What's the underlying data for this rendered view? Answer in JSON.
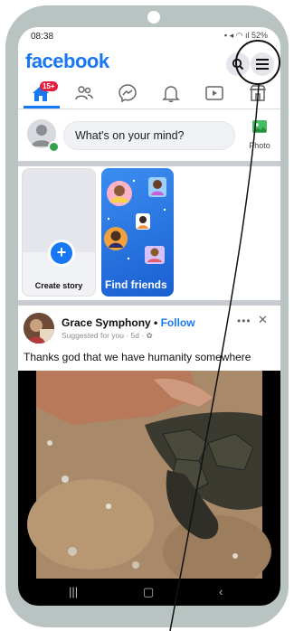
{
  "status_bar": {
    "time": "08:38",
    "battery": "52%"
  },
  "header": {
    "logo": "facebook"
  },
  "nav": {
    "notification_badge": "15+"
  },
  "composer": {
    "placeholder": "What's on your mind?",
    "photo_label": "Photo"
  },
  "stories": {
    "create_label": "Create story",
    "find_friends_label": "Find friends"
  },
  "post": {
    "author": "Grace Symphony",
    "separator": "•",
    "follow_label": "Follow",
    "meta": "Suggested for you · 5d ·",
    "text": "Thanks god that we have humanity somewhere"
  },
  "colors": {
    "brand": "#1877f2",
    "badge": "#e41e3f",
    "online": "#31a24c"
  }
}
